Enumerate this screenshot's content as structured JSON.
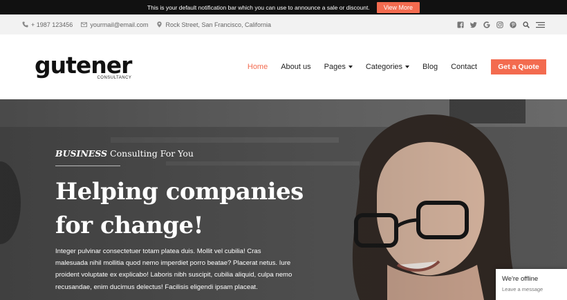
{
  "notification": {
    "text": "This is your default notification bar which you can use to announce a sale or discount.",
    "button_label": "View More"
  },
  "topbar": {
    "phone": "+ 1987 123456",
    "email": "yourmail@email.com",
    "address": "Rock Street, San Francisco, California",
    "social_icons": [
      "facebook-icon",
      "twitter-icon",
      "google-icon",
      "instagram-icon",
      "pinterest-icon",
      "search-icon",
      "menu-icon"
    ]
  },
  "header": {
    "logo_word": "gutener",
    "logo_sub": "CONSULTANCY",
    "nav": [
      {
        "label": "Home",
        "active": true
      },
      {
        "label": "About us"
      },
      {
        "label": "Pages",
        "dropdown": true
      },
      {
        "label": "Categories",
        "dropdown": true
      },
      {
        "label": "Blog"
      },
      {
        "label": "Contact"
      }
    ],
    "cta_label": "Get a Quote"
  },
  "hero": {
    "eyebrow_em": "BUSINESS",
    "eyebrow_rest": " Consulting For You",
    "headline_line1": "Helping companies",
    "headline_line2": "for change!",
    "body": "Integer pulvinar consectetuer totam platea duis. Mollit vel cubilia! Cras malesuada nihil mollitia quod nemo imperdiet porro beatae? Placerat netus. Iure proident voluptate ex explicabo! Laboris nibh suscipit, cubilia aliquid, culpa nemo recusandae, enim ducimus delectus! Facilisis eligendi ipsam placeat."
  },
  "chat": {
    "title": "We're offline",
    "subtitle": "Leave a message"
  },
  "colors": {
    "accent": "#f36b4f",
    "notification_bg": "#111111",
    "topbar_bg": "#f2f2f2"
  }
}
